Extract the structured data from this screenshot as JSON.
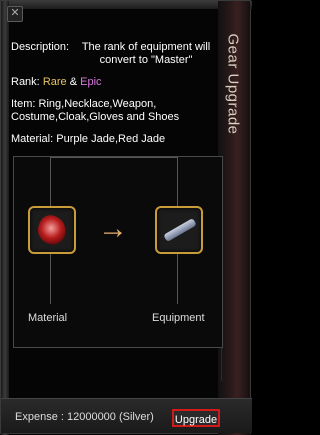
{
  "window": {
    "title": "Gear Upgrade"
  },
  "close_glyph": "✕",
  "description": {
    "label": "Description:",
    "text": "The rank of equipment will convert to \"Master\""
  },
  "rank": {
    "label": "Rank:",
    "rare": "Rare",
    "amp": "&",
    "epic": "Epic"
  },
  "item": {
    "label": "Item:",
    "text": "Ring,Necklace,Weapon, Costume,Cloak,Gloves and Shoes"
  },
  "material": {
    "label": "Material:",
    "text": "Purple Jade,Red Jade"
  },
  "slots": {
    "material_label": "Material",
    "equipment_label": "Equipment"
  },
  "icons": {
    "material_icon": "red-gem-icon",
    "equipment_icon": "sword-icon",
    "arrow_icon": "right-arrow-icon"
  },
  "footer": {
    "expense": "Expense : 12000000 (Silver)",
    "upgrade_label": "Upgrade"
  },
  "colors": {
    "rare": "#e6c55c",
    "epic": "#d87adf",
    "highlight_border": "#d21a1a",
    "slot_border": "#c99c3a"
  }
}
